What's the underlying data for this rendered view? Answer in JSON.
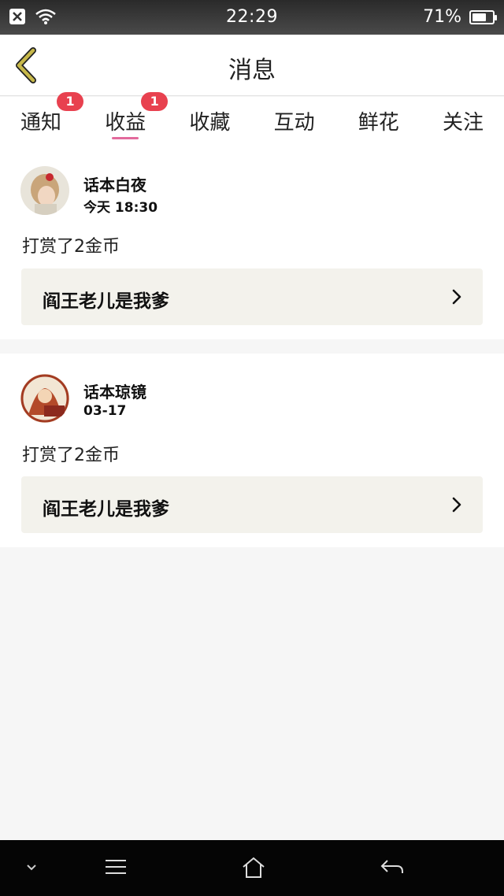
{
  "status_bar": {
    "time": "22:29",
    "battery_text": "71%",
    "battery_level": 0.71,
    "icons": [
      "close-notification-icon",
      "wifi-icon",
      "battery-icon"
    ]
  },
  "header": {
    "title": "消息",
    "back_icon": "chevron-left-icon"
  },
  "tabs": [
    {
      "label": "通知",
      "badge": "1"
    },
    {
      "label": "收益",
      "badge": "1",
      "active": true
    },
    {
      "label": "收藏"
    },
    {
      "label": "互动"
    },
    {
      "label": "鲜花"
    },
    {
      "label": "关注"
    }
  ],
  "messages": [
    {
      "user": "话本白夜",
      "time": "今天 18:30",
      "text": "打赏了2金币",
      "book": "阎王老儿是我爹"
    },
    {
      "user": "话本琼镜",
      "time": "03-17",
      "text": "打赏了2金币",
      "book": "阎王老儿是我爹"
    }
  ],
  "colors": {
    "accent": "#e36a9c",
    "badge": "#e8414f",
    "back_arrow": "#c7b84a",
    "book_bg": "#f3f2ec"
  },
  "nav_bar": {
    "icons": [
      "chevron-down-icon",
      "menu-icon",
      "home-icon",
      "back-icon"
    ]
  }
}
